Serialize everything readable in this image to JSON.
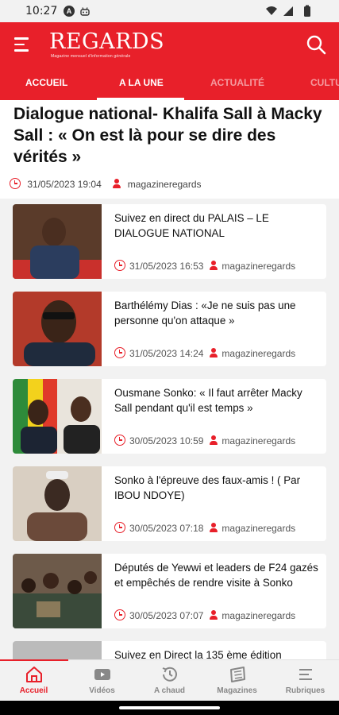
{
  "status_bar": {
    "time": "10:27",
    "a_badge": "A"
  },
  "header": {
    "logo": "REGARDS",
    "tagline": "Magazine mensuel d'information générale",
    "tabs": [
      "ACCUEIL",
      "A LA UNE",
      "ACTUALITÉ",
      "CULTURE"
    ],
    "active_tab": "A LA UNE"
  },
  "headline": {
    "title": "Dialogue national- Khalifa Sall à Macky Sall : « On est là pour se dire des vérités »",
    "date": "31/05/2023 19:04",
    "author": "magazineregards"
  },
  "articles": [
    {
      "title": "Suivez en direct du PALAIS – LE DIALOGUE NATIONAL",
      "date": "31/05/2023 16:53",
      "author": "magazineregards",
      "thumb_colors": [
        "#5a3b2a",
        "#c9302c",
        "#2b3d5e"
      ]
    },
    {
      "title": "Barthélémy Dias : «Je ne suis pas une personne qu'on attaque »",
      "date": "31/05/2023 14:24",
      "author": "magazineregards",
      "thumb_colors": [
        "#3a2418",
        "#b33a2a",
        "#1f2b3d"
      ]
    },
    {
      "title": "Ousmane Sonko: « Il faut arrêter Macky Sall pendant qu'il est temps »",
      "date": "30/05/2023 10:59",
      "author": "magazineregards",
      "thumb_colors": [
        "#2e8b3a",
        "#f3d21c",
        "#e03a2a"
      ]
    },
    {
      "title": "Sonko à l'épreuve des faux-amis ! ( Par IBOU NDOYE)",
      "date": "30/05/2023 07:18",
      "author": "magazineregards",
      "thumb_colors": [
        "#d9cfc2",
        "#3b2a22",
        "#6b4a3a"
      ]
    },
    {
      "title": "Députés de Yewwi et leaders de F24 gazés et empêchés de rendre visite à Sonko",
      "date": "30/05/2023 07:07",
      "author": "magazineregards",
      "thumb_colors": [
        "#6d5a4a",
        "#3a4a3a",
        "#8a7a5a"
      ]
    },
    {
      "title": "Suivez en Direct la 135 ème édition",
      "date": "",
      "author": "",
      "thumb_colors": [
        "#bbbbbb",
        "#999999",
        "#cccccc"
      ]
    }
  ],
  "bottom_nav": {
    "items": [
      "Accueil",
      "Vidéos",
      "A chaud",
      "Magazines",
      "Rubriques"
    ],
    "active": "Accueil"
  },
  "colors": {
    "brand_red": "#e8202a",
    "background": "#f2f2f2",
    "card": "#ffffff"
  }
}
